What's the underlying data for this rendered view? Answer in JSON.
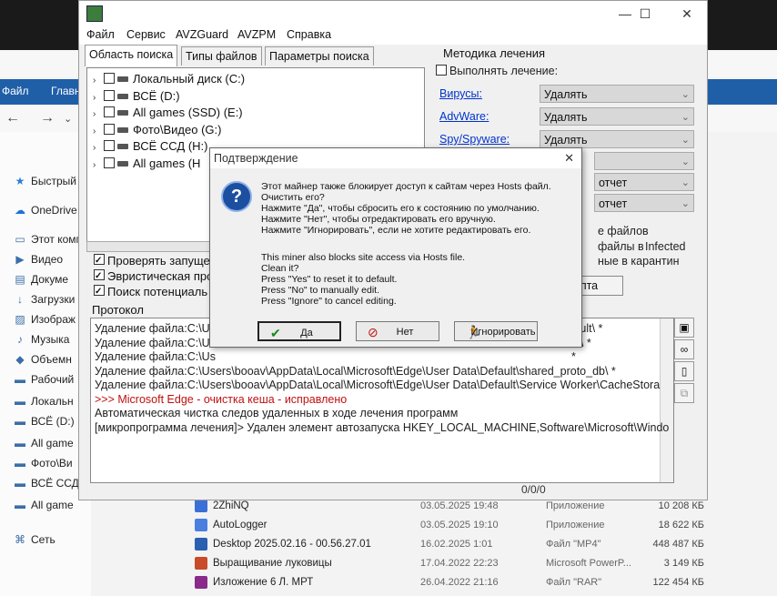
{
  "explorer": {
    "ribbon": {
      "file_tab": "Файл",
      "home_tab": "Главн"
    },
    "sidebar": [
      {
        "label": "Быстрый д",
        "icon": "star-icon"
      },
      {
        "label": "OneDrive -",
        "icon": "cloud-icon"
      },
      {
        "label": "Этот комп",
        "icon": "computer-icon"
      },
      {
        "label": "Видео",
        "icon": "video-icon"
      },
      {
        "label": "Докуме",
        "icon": "document-icon"
      },
      {
        "label": "Загрузки",
        "icon": "download-icon"
      },
      {
        "label": "Изображ",
        "icon": "image-icon"
      },
      {
        "label": "Музыка",
        "icon": "music-icon"
      },
      {
        "label": "Объемн",
        "icon": "cube-icon"
      },
      {
        "label": "Рабочий",
        "icon": "desktop-icon"
      },
      {
        "label": "Локальн",
        "icon": "drive-icon"
      },
      {
        "label": "ВСЁ (D:)",
        "icon": "drive-icon"
      },
      {
        "label": "All game",
        "icon": "drive-icon"
      },
      {
        "label": "Фото\\Ви",
        "icon": "drive-icon"
      },
      {
        "label": "ВСЁ ССД",
        "icon": "drive-icon"
      },
      {
        "label": "All game",
        "icon": "drive-icon"
      },
      {
        "label": "Сеть",
        "icon": "network-icon"
      }
    ],
    "right_sizes": [
      "КБ",
      "КБ",
      "КБ",
      "КБ",
      "КБ",
      "КБ"
    ],
    "files": [
      {
        "name": "2ZhiNQ",
        "date": "03.05.2025 19:48",
        "type": "Приложение",
        "size": "10 208 КБ",
        "color": "#3a6fd8"
      },
      {
        "name": "AutoLogger",
        "date": "03.05.2025 19:10",
        "type": "Приложение",
        "size": "18 622 КБ",
        "color": "#4a7fe0"
      },
      {
        "name": "Desktop 2025.02.16 - 00.56.27.01",
        "date": "16.02.2025 1:01",
        "type": "Файл \"MP4\"",
        "size": "448 487 КБ",
        "color": "#2b5fb0"
      },
      {
        "name": "Выращивание луковицы",
        "date": "17.04.2022 22:23",
        "type": "Microsoft PowerP...",
        "size": "3 149 КБ",
        "color": "#c84b2a"
      },
      {
        "name": "Изложение 6 Л. МРТ",
        "date": "26.04.2022 21:16",
        "type": "Файл \"RAR\"",
        "size": "122 454 КБ",
        "color": "#8a2a8a"
      }
    ]
  },
  "avz": {
    "menu": [
      "Файл",
      "Сервис",
      "AVZGuard",
      "AVZPM",
      "Справка"
    ],
    "tabs": [
      "Область поиска",
      "Типы файлов",
      "Параметры поиска"
    ],
    "tree": [
      {
        "label": "Локальный диск (C:)"
      },
      {
        "label": "ВСЁ (D:)"
      },
      {
        "label": "All games (SSD) (E:)"
      },
      {
        "label": "Фото\\Видео (G:)"
      },
      {
        "label": "ВСЁ ССД (H:)"
      },
      {
        "label": "All games (H"
      }
    ],
    "options": [
      "Проверять запущен",
      "Эвристическая про",
      "Поиск потенциаль"
    ],
    "method": {
      "title": "Методика лечения",
      "perform_label": "Выполнять лечение:",
      "rows": [
        {
          "label": "Вирусы:",
          "value": "Удалять"
        },
        {
          "label": "AdvWare:",
          "value": "Удалять"
        },
        {
          "label": "Spy/Spyware:",
          "value": "Удалять"
        },
        {
          "label": "",
          "value": ""
        },
        {
          "label": "",
          "value": "отчет"
        },
        {
          "label": "",
          "value": "отчет"
        }
      ],
      "extra1": "е файлов",
      "extra2": "файлы в",
      "extra2b": "Infected",
      "extra3": "ные в карантин",
      "script_button": "ипта"
    },
    "protocol_label": "Протокол",
    "log": [
      {
        "text": "Удаление файла:C:\\Us",
        "red": false
      },
      {
        "text": "Удаление файла:C:\\Us",
        "red": false
      },
      {
        "text": "Удаление файла:C:\\Us",
        "red": false
      },
      {
        "text": "Удаление файла:C:\\Users\\booav\\AppData\\Local\\Microsoft\\Edge\\User Data\\Default\\shared_proto_db\\ *",
        "red": false
      },
      {
        "text": "Удаление файла:C:\\Users\\booav\\AppData\\Local\\Microsoft\\Edge\\User Data\\Default\\Service Worker\\CacheStora",
        "red": false
      },
      {
        "text": " >>>  Microsoft Edge - очистка кеша - исправлено",
        "red": true
      },
      {
        "text": "Автоматическая чистка следов удаленных в ходе лечения программ",
        "red": false
      },
      {
        "text": "[микропрограмма лечения]> Удален элемент автозапуска HKEY_LOCAL_MACHINE,Software\\Microsoft\\Windo",
        "red": false
      }
    ],
    "log_tails": [
      "efault\\ *",
      "ed\\ *",
      "*"
    ],
    "counter": "0/0/0"
  },
  "dialog": {
    "title": "Подтверждение",
    "lines": [
      "Этот майнер также блокирует доступ к сайтам через Hosts файл.",
      "Очистить его?",
      "Нажмите \"Да\", чтобы сбросить его к состоянию по умолчанию.",
      "Нажмите \"Нет\", чтобы отредактировать его вручную.",
      "Нажмите \"Игнорировать\", если не хотите редактировать его.",
      "",
      "This miner also blocks site access via Hosts file.",
      "Clean it?",
      "Press \"Yes\" to reset it to default.",
      "Press \"No\" to manually edit.",
      "Press \"Ignore\" to cancel editing."
    ],
    "buttons": {
      "yes": "Да",
      "no": "Нет",
      "ignore": "Игнорировать"
    }
  }
}
